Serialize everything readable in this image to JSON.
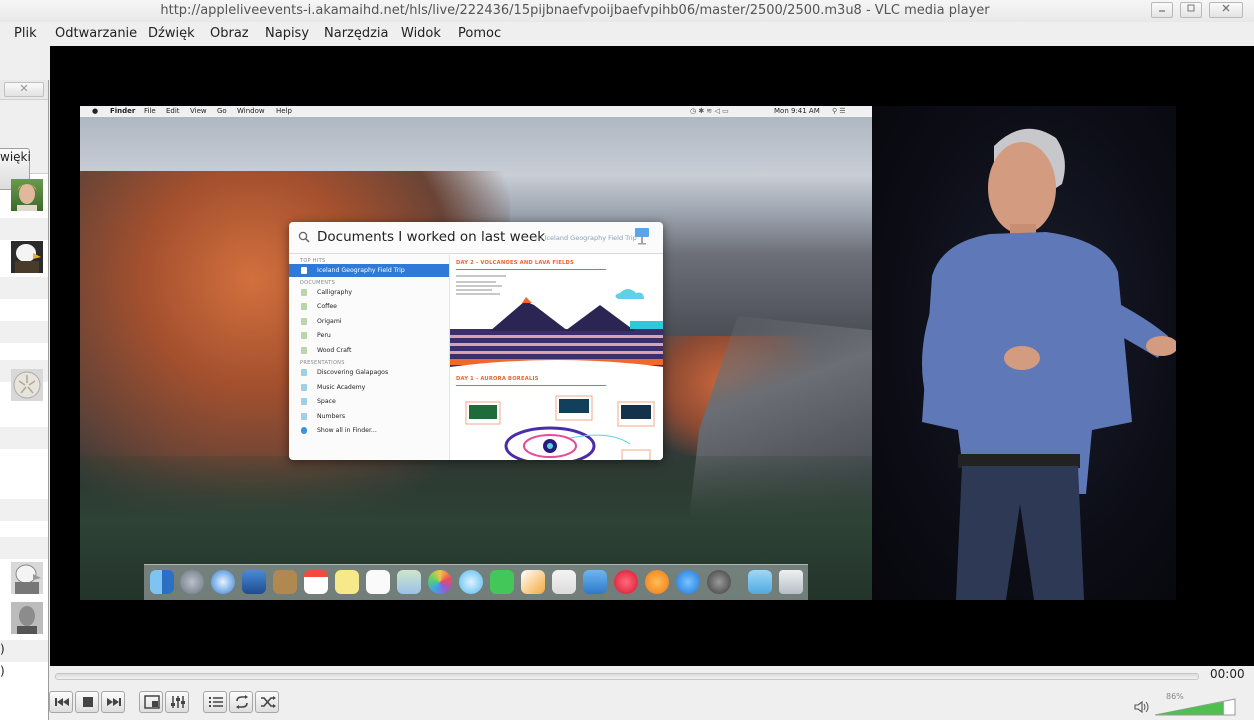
{
  "window": {
    "title": "http://appleliveevents-i.akamaihd.net/hls/live/222436/15pijbnaefvpoijbaefvpihb06/master/2500/2500.m3u8 - VLC media player",
    "buttons": [
      "minimize",
      "maximize",
      "close"
    ]
  },
  "menubar": {
    "items": [
      "Plik",
      "Odtwarzanie",
      "Dźwięk",
      "Obraz",
      "Napisy",
      "Narzędzia",
      "Widok",
      "Pomoc"
    ]
  },
  "left_panel": {
    "button_label": "więki",
    "bottom_text": [
      ")",
      ")"
    ]
  },
  "mac": {
    "menubar": [
      "Finder",
      "File",
      "Edit",
      "View",
      "Go",
      "Window",
      "Help"
    ],
    "clock": "Mon 9:41 AM"
  },
  "spotlight": {
    "query": "Documents I worked on last week",
    "hint": "— Iceland Geography Field Trip",
    "sections": {
      "top_hits": "TOP HITS",
      "documents": "DOCUMENTS",
      "presentations": "PRESENTATIONS"
    },
    "top_hit": "Iceland Geography Field Trip",
    "documents": [
      "Calligraphy",
      "Coffee",
      "Origami",
      "Peru",
      "Wood Craft"
    ],
    "presentations": [
      "Discovering Galapagos",
      "Music Academy",
      "Space",
      "Numbers"
    ],
    "show_all": "Show all in Finder...",
    "preview": {
      "heading1": "DAY 2 - VOLCANOES AND LAVA FIELDS",
      "heading2": "DAY 1 - AURORA BOREALIS"
    }
  },
  "controls": {
    "time": "00:00",
    "volume_percent": "86%",
    "volume_level": 0.86,
    "progress": 0
  }
}
